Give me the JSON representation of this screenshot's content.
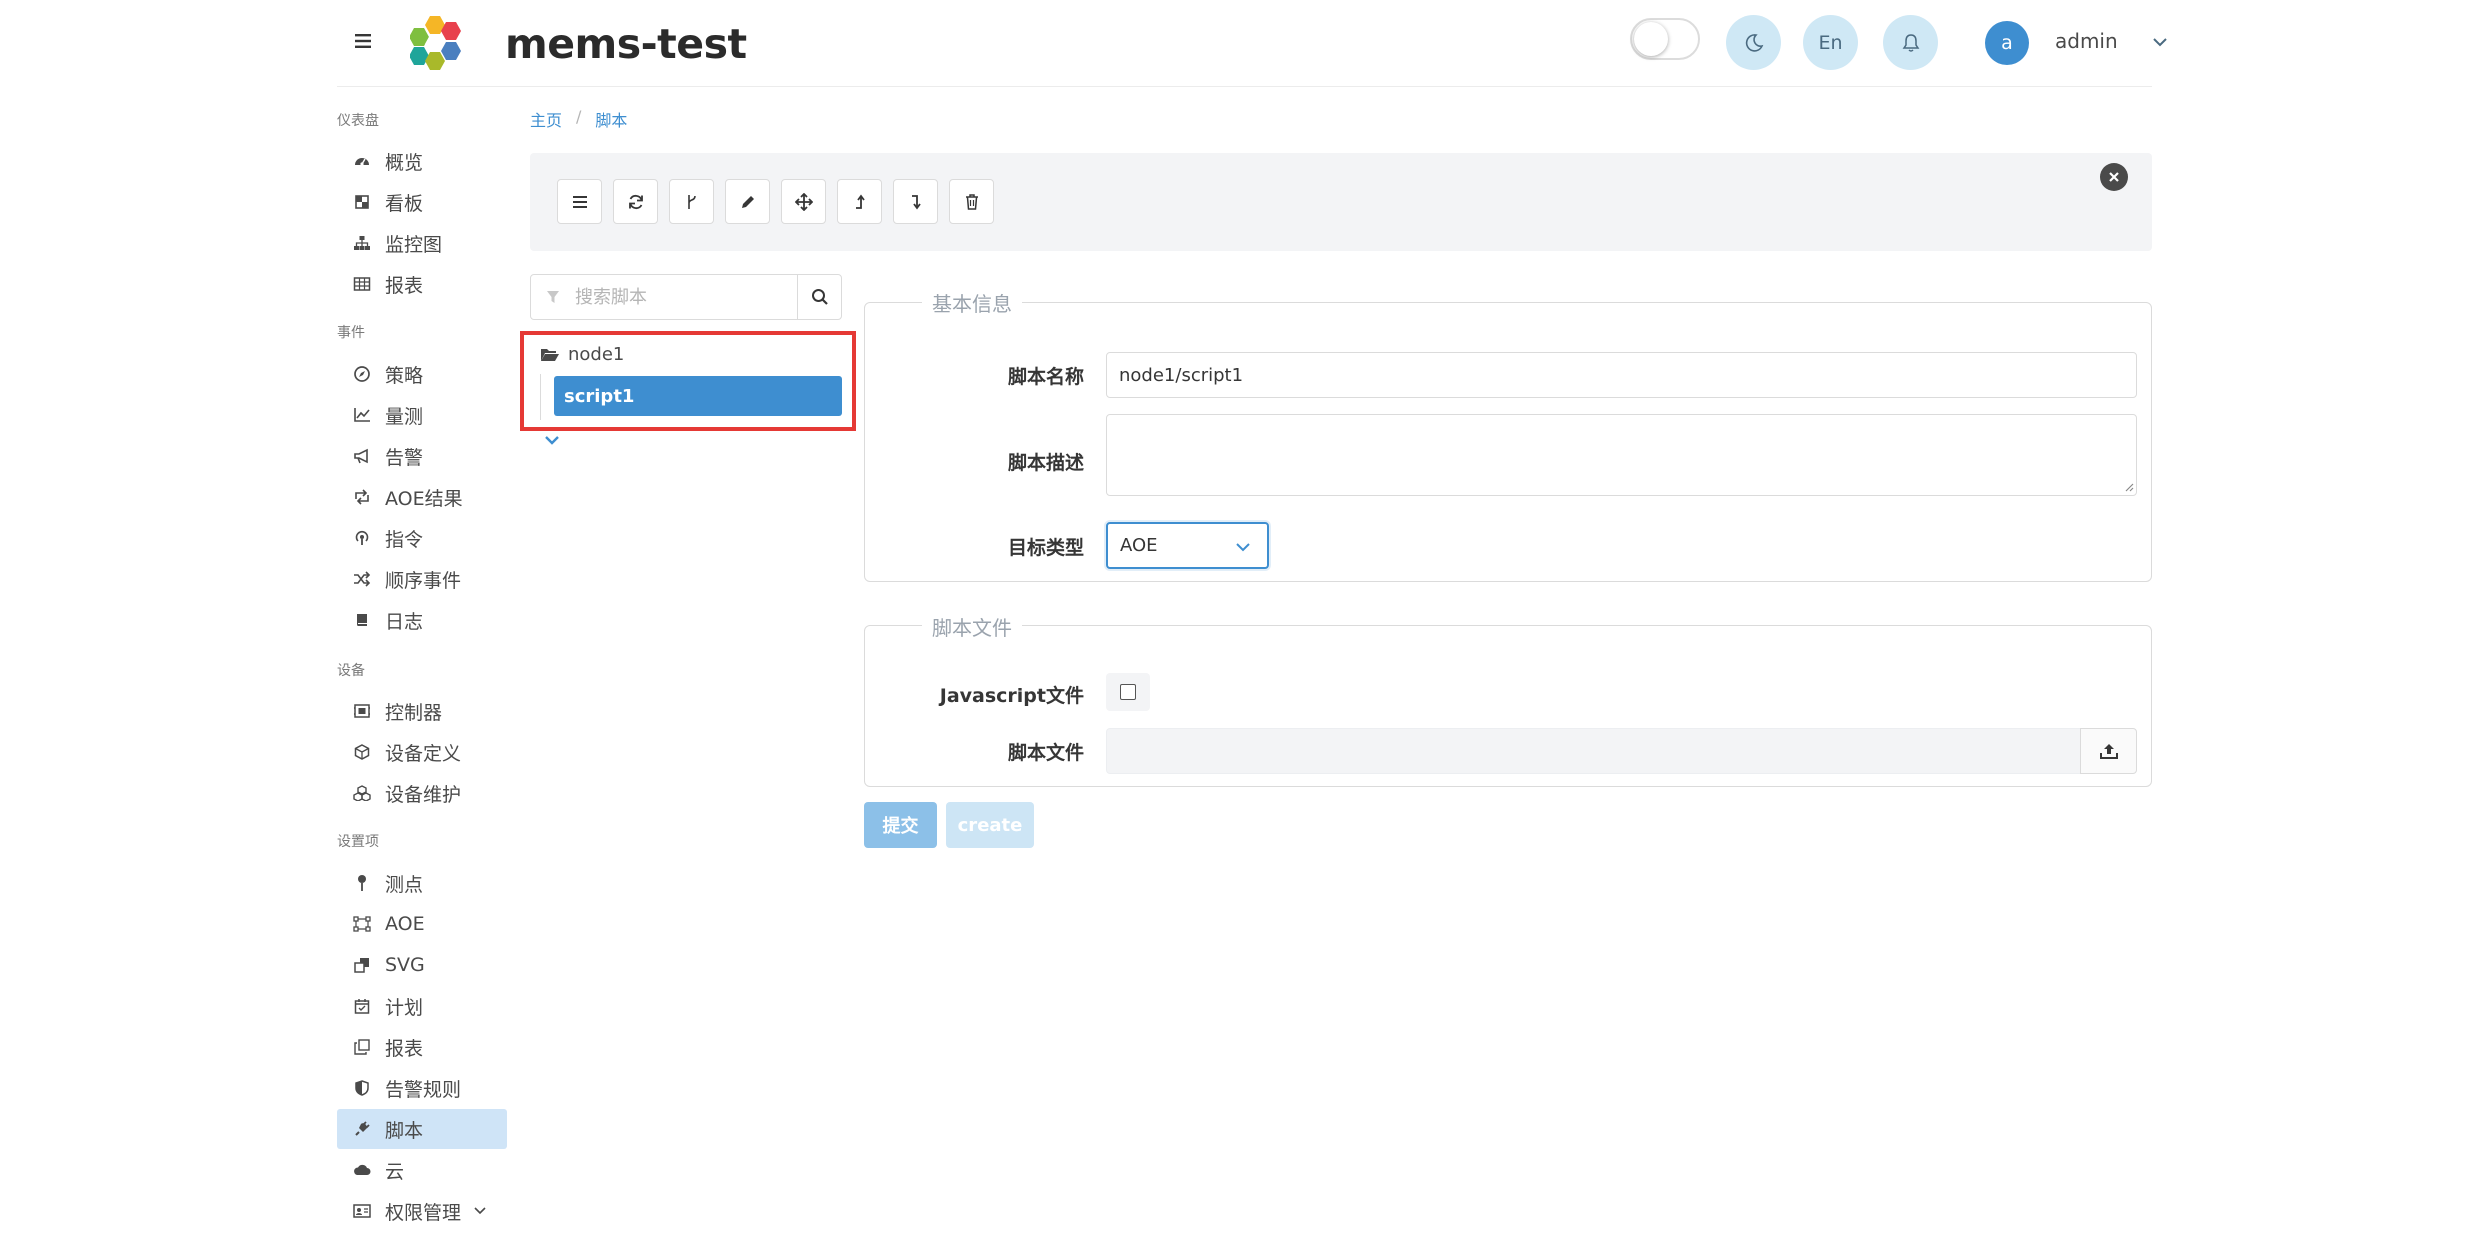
{
  "header": {
    "app_title": "mems-test",
    "lang_label": "En",
    "avatar_letter": "a",
    "user_name": "admin"
  },
  "sidebar": {
    "sections": [
      {
        "label": "仪表盘",
        "items": [
          {
            "label": "概览",
            "icon": "dashboard-icon"
          },
          {
            "label": "看板",
            "icon": "board-icon"
          },
          {
            "label": "监控图",
            "icon": "sitemap-icon"
          },
          {
            "label": "报表",
            "icon": "table-icon"
          }
        ]
      },
      {
        "label": "事件",
        "items": [
          {
            "label": "策略",
            "icon": "compass-icon"
          },
          {
            "label": "量测",
            "icon": "chart-line-icon"
          },
          {
            "label": "告警",
            "icon": "bullhorn-icon"
          },
          {
            "label": "AOE结果",
            "icon": "retweet-icon"
          },
          {
            "label": "指令",
            "icon": "podcast-icon"
          },
          {
            "label": "顺序事件",
            "icon": "random-icon"
          },
          {
            "label": "日志",
            "icon": "book-icon"
          }
        ]
      },
      {
        "label": "设备",
        "items": [
          {
            "label": "控制器",
            "icon": "controller-icon"
          },
          {
            "label": "设备定义",
            "icon": "cube-icon"
          },
          {
            "label": "设备维护",
            "icon": "cubes-icon"
          }
        ]
      },
      {
        "label": "设置项",
        "items": [
          {
            "label": "测点",
            "icon": "map-pin-icon"
          },
          {
            "label": "AOE",
            "icon": "vector-icon"
          },
          {
            "label": "SVG",
            "icon": "clone-icon"
          },
          {
            "label": "计划",
            "icon": "calendar-icon"
          },
          {
            "label": "报表",
            "icon": "copy-icon"
          },
          {
            "label": "告警规则",
            "icon": "shield-icon"
          },
          {
            "label": "脚本",
            "icon": "plug-icon",
            "active": true
          },
          {
            "label": "云",
            "icon": "cloud-icon"
          },
          {
            "label": "权限管理",
            "icon": "id-card-icon",
            "has_submenu": true
          }
        ]
      }
    ]
  },
  "breadcrumb": [
    "主页",
    "脚本"
  ],
  "toolbar": {
    "buttons": [
      "list-icon",
      "refresh-icon",
      "branch-icon",
      "pencil-icon",
      "move-icon",
      "move-up-icon",
      "move-down-icon",
      "trash-icon"
    ]
  },
  "search": {
    "placeholder": "搜索脚本"
  },
  "tree": {
    "folder": "node1",
    "selected_item": "script1"
  },
  "basic_info": {
    "legend": "基本信息",
    "name_label": "脚本名称",
    "name_value": "node1/script1",
    "desc_label": "脚本描述",
    "desc_value": "",
    "target_label": "目标类型",
    "target_value": "AOE"
  },
  "script_file": {
    "legend": "脚本文件",
    "js_label": "Javascript文件",
    "js_checked": false,
    "file_label": "脚本文件",
    "file_value": ""
  },
  "actions": {
    "submit_label": "提交",
    "create_label": "create"
  },
  "colors": {
    "primary": "#3e8ed0",
    "active_bg": "#cfe4f7",
    "highlight_border": "#e53935"
  }
}
